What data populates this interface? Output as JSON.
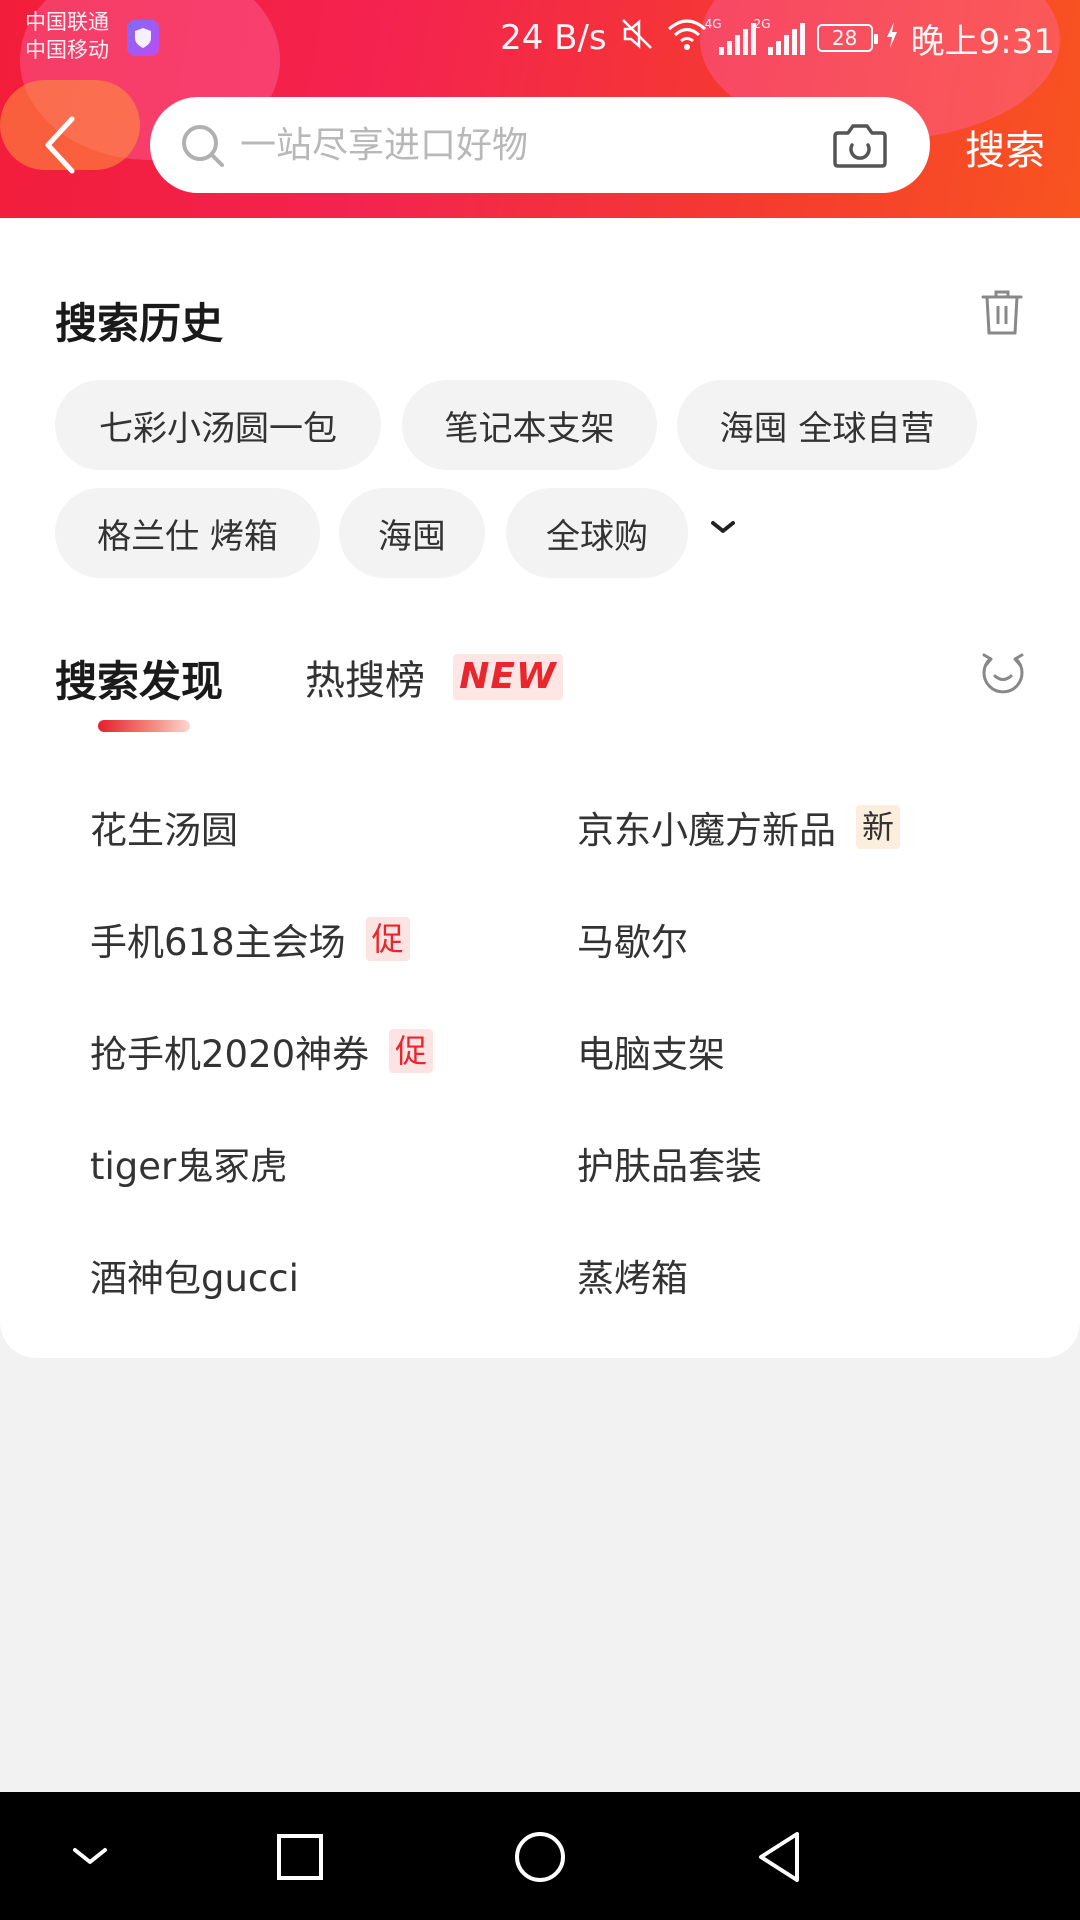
{
  "status_bar": {
    "carrier_1": "中国联通",
    "carrier_2": "中国移动",
    "net_speed": "24 B/s",
    "signal_1_tag": "4G",
    "signal_2_tag": "2G",
    "battery": "28",
    "time": "晚上9:31"
  },
  "search": {
    "placeholder": "一站尽享进口好物",
    "button_label": "搜索"
  },
  "history": {
    "title": "搜索历史",
    "items": [
      "七彩小汤圆一包",
      "笔记本支架",
      "海囤 全球自营",
      "格兰仕 烤箱",
      "海囤",
      "全球购"
    ]
  },
  "discover": {
    "tab_active": "搜索发现",
    "tab_hot": "热搜榜",
    "new_badge": "NEW",
    "left": [
      {
        "text": "花生汤圆",
        "badge": ""
      },
      {
        "text": "手机618主会场",
        "badge": "促"
      },
      {
        "text": "抢手机2020神券",
        "badge": "促"
      },
      {
        "text": "tiger鬼冢虎",
        "badge": ""
      },
      {
        "text": "酒神包gucci",
        "badge": ""
      }
    ],
    "right": [
      {
        "text": "京东小魔方新品",
        "badge": "新"
      },
      {
        "text": "马歇尔",
        "badge": ""
      },
      {
        "text": "电脑支架",
        "badge": ""
      },
      {
        "text": "护肤品套装",
        "badge": ""
      },
      {
        "text": "蒸烤箱",
        "badge": ""
      }
    ]
  },
  "colors": {
    "accent_red": "#e8262d",
    "header_gradient_start": "#f21d3a",
    "header_gradient_end": "#f85420"
  }
}
